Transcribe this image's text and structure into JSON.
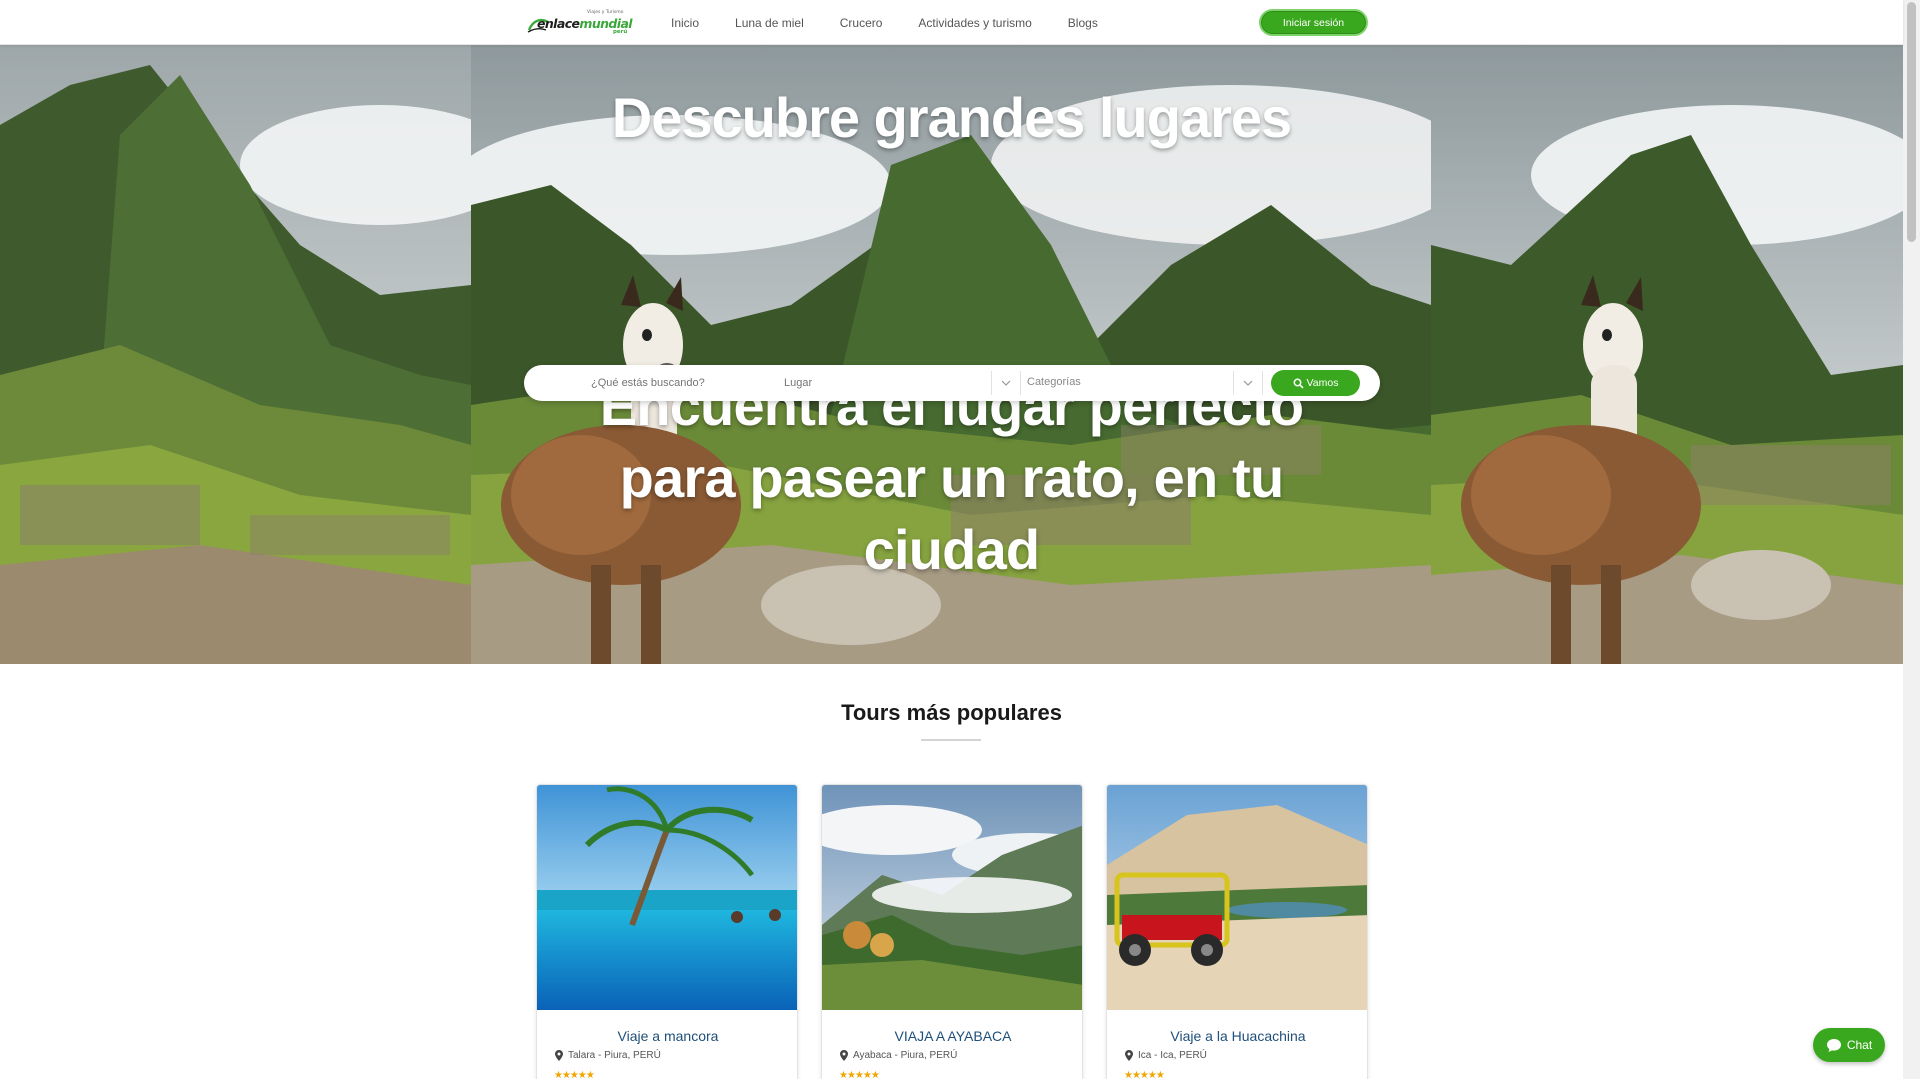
{
  "brand": {
    "logo_text_a": "enlace",
    "logo_text_b": "mundial",
    "logo_tagline": "Viajes y Turismo",
    "logo_country": "perú"
  },
  "nav": {
    "items": [
      {
        "label": "Inicio"
      },
      {
        "label": "Luna de miel"
      },
      {
        "label": "Crucero"
      },
      {
        "label": "Actividades y turismo"
      },
      {
        "label": "Blogs"
      }
    ],
    "login_label": "Iniciar sesión"
  },
  "hero": {
    "title": "Descubre grandes lugares",
    "subtitle": "Encuentra el lugar perfecto para pasear un rato, en tu ciudad"
  },
  "search": {
    "what_placeholder": "¿Qué estás buscando?",
    "place_placeholder": "Lugar",
    "category_label": "Categorías",
    "button_label": "Vamos"
  },
  "section": {
    "title": "Tours más populares"
  },
  "tours": [
    {
      "title": "Viaje a mancora",
      "location": "Talara - Piura, PERÚ",
      "rating": 5
    },
    {
      "title": "VIAJA A AYABACA",
      "location": "Ayabaca - Piura, PERÚ",
      "rating": 5
    },
    {
      "title": "Viaje a la Huacachina",
      "location": "Ica - Ica, PERÚ",
      "rating": 5
    }
  ],
  "chat": {
    "label": "Chat"
  },
  "colors": {
    "accent": "#3aa81e",
    "card_title": "#1f4f7a",
    "star": "#f0a500"
  }
}
